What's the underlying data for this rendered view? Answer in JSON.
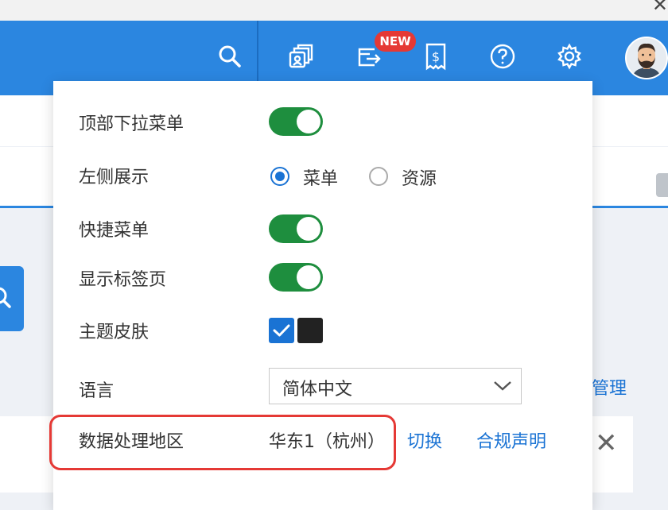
{
  "header": {
    "new_badge": "NEW",
    "icons": [
      "search-icon",
      "cards-icon",
      "transfer-icon",
      "billing-icon",
      "help-icon",
      "gear-icon"
    ]
  },
  "background": {
    "manage_link": "管理"
  },
  "settings": {
    "top_dropdown_menu": {
      "label": "顶部下拉菜单",
      "enabled": true
    },
    "left_display": {
      "label": "左侧展示",
      "options": [
        "菜单",
        "资源"
      ],
      "selected": "菜单"
    },
    "quick_menu": {
      "label": "快捷菜单",
      "enabled": true
    },
    "show_tabs": {
      "label": "显示标签页",
      "enabled": true
    },
    "theme_skin": {
      "label": "主题皮肤",
      "colors": [
        "#1a73d4",
        "#222222"
      ],
      "selected": "#1a73d4"
    },
    "language": {
      "label": "语言",
      "value": "简体中文"
    },
    "data_region": {
      "label": "数据处理地区",
      "value": "华东1（杭州）",
      "switch_link": "切换",
      "compliance_link": "合规声明"
    }
  },
  "colors": {
    "header_blue": "#2b86e0",
    "toggle_green": "#1e8e3e",
    "link_blue": "#1a73d4",
    "highlight_red": "#e53935"
  }
}
